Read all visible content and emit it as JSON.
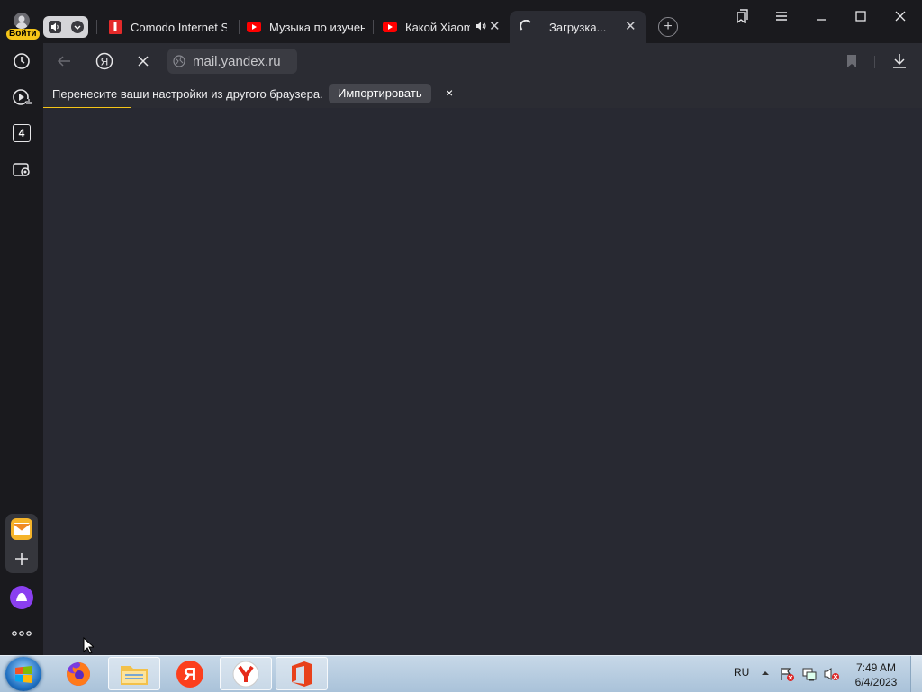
{
  "sidebar": {
    "login_label": "Войти",
    "tabs_count": "4",
    "icons": [
      "clock-icon",
      "video-icon",
      "tabs-counter",
      "screenshot-icon",
      "mail-icon",
      "plus-icon",
      "alice-icon",
      "more-icon"
    ]
  },
  "tabs": [
    {
      "title": "Comodo Internet S",
      "favicon": "comodo-icon",
      "audio": false
    },
    {
      "title": "Музыка по изучен",
      "favicon": "youtube-icon",
      "audio": false
    },
    {
      "title": "Какой Xiaomi",
      "favicon": "youtube-icon",
      "audio": true
    },
    {
      "title": "Загрузка...",
      "favicon": "loading-spinner",
      "active": true
    }
  ],
  "toolbar": {
    "url": "mail.yandex.ru"
  },
  "infobar": {
    "message": "Перенесите ваши настройки из другого браузера.",
    "import_label": "Импортировать",
    "close_label": "×"
  },
  "page_load_progress": 0.1,
  "taskbar": {
    "language": "RU",
    "time": "7:49 AM",
    "date": "6/4/2023",
    "apps": [
      "firefox",
      "file-explorer",
      "yandex",
      "yandex-browser",
      "office"
    ]
  },
  "colors": {
    "accent": "#f5c518",
    "background": "#282932",
    "toolbar": "#2b2c33",
    "youtube": "#ff0000"
  }
}
